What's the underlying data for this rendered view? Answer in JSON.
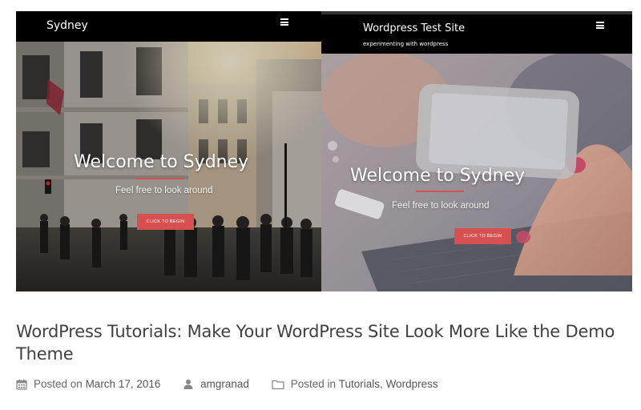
{
  "hero": {
    "left": {
      "site_title": "Sydney",
      "welcome": "Welcome to Sydney",
      "subtitle": "Feel free to look around",
      "cta": "Click to begin"
    },
    "right": {
      "site_title": "Wordpress Test Site",
      "tagline": "experimenting with wordpress",
      "welcome": "Welcome to Sydney",
      "subtitle": "Feel free to look around",
      "cta": "Click to begin"
    }
  },
  "post": {
    "title": "WordPress Tutorials: Make Your WordPress Site Look More Like the Demo Theme",
    "meta": {
      "posted_on_label": "Posted on",
      "date": "March 17, 2016",
      "author": "amgranad",
      "posted_in_label": "Posted in",
      "categories": [
        "Tutorials",
        "Wordpress"
      ],
      "separator": ","
    }
  },
  "colors": {
    "accent": "#d65050",
    "title": "#443f3f",
    "bar": "#000000"
  },
  "icons": {
    "calendar": "calendar-icon",
    "author": "user-icon",
    "folder": "folder-icon",
    "menu": "hamburger-menu-icon"
  }
}
